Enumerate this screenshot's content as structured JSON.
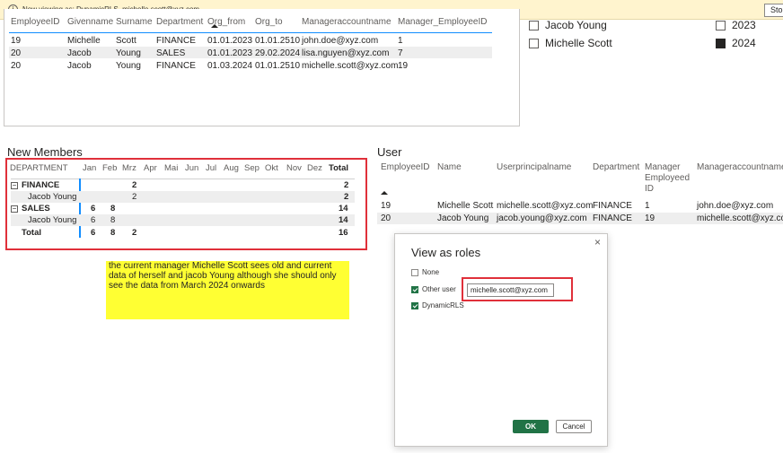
{
  "banner": {
    "message": "Now viewing as: DynamicRLS, michelle.scott@xyz.com",
    "stop_label": "Stop"
  },
  "top_table": {
    "columns": [
      "EmployeeID",
      "Givenname",
      "Surname",
      "Department",
      "Org_from",
      "Org_to",
      "Manageraccountname",
      "Manager_EmployeeID"
    ],
    "rows": [
      [
        "19",
        "Michelle",
        "Scott",
        "FINANCE",
        "01.01.2023",
        "01.01.2510",
        "john.doe@xyz.com",
        "1"
      ],
      [
        "20",
        "Jacob",
        "Young",
        "SALES",
        "01.01.2023",
        "29.02.2024",
        "lisa.nguyen@xyz.com",
        "7"
      ],
      [
        "20",
        "Jacob",
        "Young",
        "FINANCE",
        "01.03.2024",
        "01.01.2510",
        "michelle.scott@xyz.com",
        "19"
      ]
    ]
  },
  "slicer_names": {
    "items": [
      {
        "label": "Jacob Young",
        "checked": false
      },
      {
        "label": "Michelle Scott",
        "checked": false
      }
    ]
  },
  "slicer_years": {
    "items": [
      {
        "label": "2023",
        "checked": false
      },
      {
        "label": "2024",
        "checked": true
      }
    ]
  },
  "new_members": {
    "title": "New Members",
    "header": [
      "DEPARTMENT",
      "Jan",
      "Feb",
      "Mrz",
      "Apr",
      "Mai",
      "Jun",
      "Jul",
      "Aug",
      "Sep",
      "Okt",
      "Nov",
      "Dez",
      "Total"
    ],
    "rows": [
      {
        "label": "FINANCE",
        "level": 0,
        "expander": "−",
        "jan": "",
        "feb": "",
        "mrz": "2",
        "total": "2"
      },
      {
        "label": "Jacob Young",
        "level": 1,
        "expander": "",
        "jan": "",
        "feb": "",
        "mrz": "2",
        "total": "2"
      },
      {
        "label": "SALES",
        "level": 0,
        "expander": "−",
        "jan": "6",
        "feb": "8",
        "mrz": "",
        "total": "14"
      },
      {
        "label": "Jacob Young",
        "level": 1,
        "expander": "",
        "jan": "6",
        "feb": "8",
        "mrz": "",
        "total": "14"
      },
      {
        "label": "Total",
        "level": 0,
        "expander": "",
        "jan": "6",
        "feb": "8",
        "mrz": "2",
        "total": "16"
      }
    ]
  },
  "note": {
    "text": "the current manager Michelle Scott sees old and current data of herself and jacob Young although she should only see the data from March 2024 onwards"
  },
  "user": {
    "title": "User",
    "columns": [
      "EmployeeID",
      "Name",
      "Userprincipalname",
      "Department",
      "Manager Employeed ID",
      "Manageraccountname"
    ],
    "rows": [
      [
        "19",
        "Michelle Scott",
        "michelle.scott@xyz.com",
        "FINANCE",
        "1",
        "john.doe@xyz.com"
      ],
      [
        "20",
        "Jacob Young",
        "jacob.young@xyz.com",
        "FINANCE",
        "19",
        "michelle.scott@xyz.com"
      ]
    ]
  },
  "dialog": {
    "title": "View as roles",
    "close_icon": "×",
    "options": [
      {
        "label": "None",
        "checked": false
      },
      {
        "label": "Other user",
        "checked": true
      },
      {
        "label": "DynamicRLS",
        "checked": true
      }
    ],
    "other_user_value": "michelle.scott@xyz.com",
    "ok_label": "OK",
    "cancel_label": "Cancel"
  },
  "colors": {
    "accent_blue": "#118dff",
    "highlight_red": "#e0303a",
    "note_yellow": "#ffff33",
    "ok_green": "#217346",
    "banner_bg": "#fff4ce"
  }
}
